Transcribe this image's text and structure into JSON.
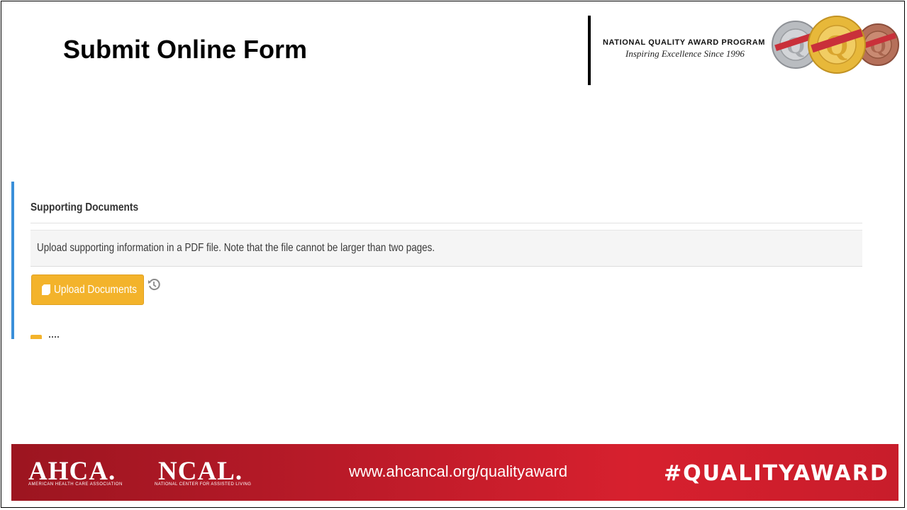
{
  "slide": {
    "title": "Submit Online Form"
  },
  "header": {
    "program_name": "NATIONAL QUALITY AWARD PROGRAM",
    "tagline": "Inspiring Excellence Since 1996",
    "medals": {
      "icon": "award-medals",
      "colors": [
        "#b9bcc0",
        "#e7b83a",
        "#b5705a"
      ]
    }
  },
  "form": {
    "accent_color": "#3a8fd9",
    "section_title": "Supporting Documents",
    "info_text": "Upload supporting information in a PDF file. Note that the file cannot be larger than two pages.",
    "upload_button": {
      "label": "Upload Documents",
      "icon": "document-icon",
      "color": "#f3b32b"
    },
    "history_icon": "history-icon"
  },
  "footer": {
    "ahca_logo": "AHCA.",
    "ahca_subtitle": "AMERICAN HEALTH CARE ASSOCIATION",
    "ncal_logo": "NCAL.",
    "ncal_subtitle": "NATIONAL CENTER FOR ASSISTED LIVING",
    "url": "www.ahcancal.org/qualityaward",
    "hashtag": "#QUALITYAWARD",
    "color": "#c81d2b"
  }
}
